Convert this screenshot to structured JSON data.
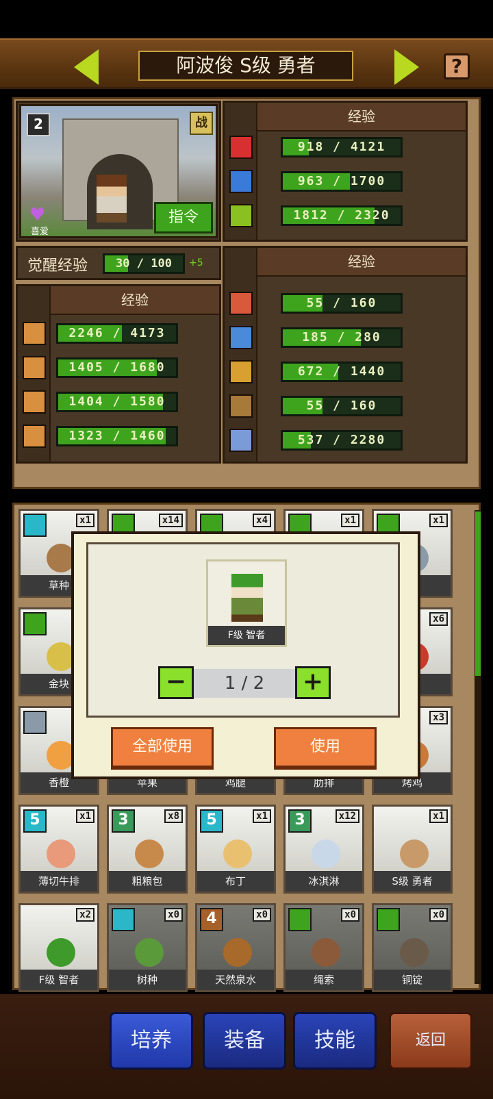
{
  "header": {
    "title": "阿波俊 S级 勇者",
    "help_symbol": "?"
  },
  "hero": {
    "rank": "2",
    "battle_tag": "战",
    "command_label": "指令",
    "like_label": "喜爱",
    "awaken_label": "觉醒经验",
    "awaken_value": "30 / 100",
    "awaken_progress": 0.3,
    "awaken_bonus": "+5"
  },
  "vitals": {
    "header": "经验",
    "rows": [
      {
        "icon": "heart-icon",
        "color": "#d83030",
        "value": "918 / 4121",
        "progress": 0.22
      },
      {
        "icon": "potion-icon",
        "color": "#3a7ad8",
        "value": "963 / 1700",
        "progress": 0.57
      },
      {
        "icon": "stamina-icon",
        "color": "#8ac020",
        "value": "1812 / 2320",
        "progress": 0.78
      }
    ]
  },
  "combat": {
    "header": "经验",
    "rows": [
      {
        "icon": "sword-icon",
        "value": "2246 / 4173",
        "progress": 0.54
      },
      {
        "icon": "shield-icon",
        "value": "1405 / 1680",
        "progress": 0.84
      },
      {
        "icon": "speed-icon",
        "value": "1404 / 1580",
        "progress": 0.89
      },
      {
        "icon": "star-icon",
        "value": "1323 / 1460",
        "progress": 0.91
      }
    ]
  },
  "crafting": {
    "header": "经验",
    "rows": [
      {
        "icon": "book-icon",
        "color": "#d85a3a",
        "value": "55 / 160",
        "progress": 0.34
      },
      {
        "icon": "pickaxe-icon",
        "color": "#4a8ad8",
        "value": "185 / 280",
        "progress": 0.66
      },
      {
        "icon": "shovel-icon",
        "color": "#d8a030",
        "value": "672 / 1440",
        "progress": 0.47
      },
      {
        "icon": "basket-icon",
        "color": "#a87a3a",
        "value": "55 / 160",
        "progress": 0.34
      },
      {
        "icon": "hammer-icon",
        "color": "#7a9ad8",
        "value": "537 / 2280",
        "progress": 0.24
      }
    ]
  },
  "inventory": [
    {
      "name": "草种",
      "count": "x1",
      "tag": "",
      "tag_color": "#2ab8c8",
      "pic": "#a87a4a"
    },
    {
      "name": "",
      "count": "x14",
      "tag": "",
      "tag_color": "#3ea41e",
      "pic": "#a08060"
    },
    {
      "name": "",
      "count": "x4",
      "tag": "",
      "tag_color": "#3ea41e",
      "pic": "#a08060"
    },
    {
      "name": "",
      "count": "x1",
      "tag": "",
      "tag_color": "#3ea41e",
      "pic": "#a08060"
    },
    {
      "name": "矿",
      "count": "x1",
      "tag": "",
      "tag_color": "#3ea41e",
      "pic": "#8a9aa8"
    },
    {
      "name": "金块",
      "count": "",
      "tag": "",
      "tag_color": "#3ea41e",
      "pic": "#d8c048"
    },
    {
      "name": "",
      "count": "",
      "tag": "",
      "tag_color": "",
      "pic": ""
    },
    {
      "name": "",
      "count": "",
      "tag": "",
      "tag_color": "",
      "pic": ""
    },
    {
      "name": "",
      "count": "",
      "tag": "",
      "tag_color": "",
      "pic": ""
    },
    {
      "name": "果",
      "count": "x6",
      "tag": "",
      "tag_color": "",
      "pic": "#c83a2a"
    },
    {
      "name": "香橙",
      "count": "",
      "tag": "",
      "tag_color": "#8a9aa8",
      "pic": "#f0a040"
    },
    {
      "name": "苹果",
      "count": "",
      "tag": "",
      "tag_color": "",
      "pic": ""
    },
    {
      "name": "鸡腿",
      "count": "",
      "tag": "",
      "tag_color": "",
      "pic": ""
    },
    {
      "name": "肋排",
      "count": "",
      "tag": "",
      "tag_color": "",
      "pic": ""
    },
    {
      "name": "烤鸡",
      "count": "x3",
      "tag": "",
      "tag_color": "",
      "pic": "#c87a3a"
    },
    {
      "name": "薄切牛排",
      "count": "x1",
      "tag": "5",
      "tag_color": "#2ab8c8",
      "pic": "#e89a7a"
    },
    {
      "name": "粗粮包",
      "count": "x8",
      "tag": "3",
      "tag_color": "#3a9a5a",
      "pic": "#c88a4a"
    },
    {
      "name": "布丁",
      "count": "x1",
      "tag": "5",
      "tag_color": "#2ab8c8",
      "pic": "#e8c070"
    },
    {
      "name": "冰淇淋",
      "count": "x12",
      "tag": "3",
      "tag_color": "#3a9a5a",
      "pic": "#c8d8e8"
    },
    {
      "name": "S级 勇者",
      "count": "x1",
      "tag": "",
      "tag_color": "",
      "pic": "#c89a6a"
    },
    {
      "name": "F级 智者",
      "count": "x2",
      "tag": "",
      "tag_color": "",
      "pic": "#3e9a2a"
    },
    {
      "name": "树种",
      "count": "x0",
      "tag": "",
      "tag_color": "#2ab8c8",
      "pic": "#5a9a3a",
      "dark": true
    },
    {
      "name": "天然泉水",
      "count": "x0",
      "tag": "4",
      "tag_color": "#a8602a",
      "pic": "#a86a2a",
      "dark": true
    },
    {
      "name": "绳索",
      "count": "x0",
      "tag": "",
      "tag_color": "#3ea41e",
      "pic": "#8a5a3a",
      "dark": true
    },
    {
      "name": "铜锭",
      "count": "x0",
      "tag": "",
      "tag_color": "#3ea41e",
      "pic": "#6a5a4a",
      "dark": true
    }
  ],
  "modal": {
    "item_name": "F级 智者",
    "minus": "−",
    "plus": "+",
    "quantity": "1 / 2",
    "use_all_label": "全部使用",
    "use_label": "使用"
  },
  "nav": {
    "train": "培养",
    "equip": "装备",
    "skill": "技能",
    "back": "返回"
  }
}
